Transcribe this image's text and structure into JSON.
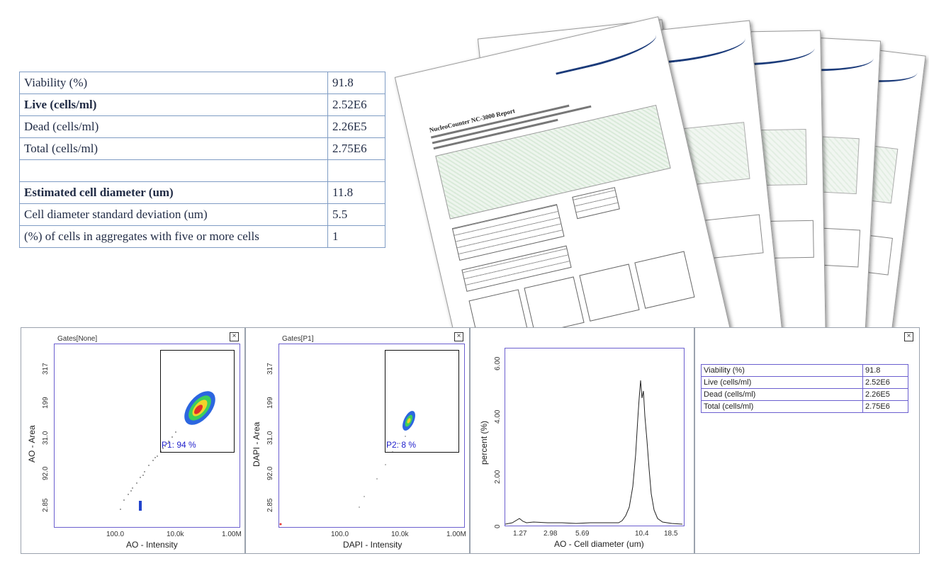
{
  "summary_table": [
    {
      "label": "Viability (%)",
      "value": "91.8"
    },
    {
      "label": "Live (cells/ml)",
      "value": "2.52E6"
    },
    {
      "label": "Dead (cells/ml)",
      "value": "2.26E5"
    },
    {
      "label": "Total (cells/ml)",
      "value": "2.75E6"
    },
    {
      "label": "",
      "value": ""
    },
    {
      "label": "Estimated cell diameter (um)",
      "value": "11.8"
    },
    {
      "label": "Cell diameter standard deviation (um)",
      "value": "5.5"
    },
    {
      "label": "(%) of cells in aggregates with five or more cells",
      "value": "1"
    }
  ],
  "report": {
    "title": "NucleoCounter NC-3000 Report"
  },
  "panels": {
    "p1": {
      "gates": "Gates[None]",
      "ylabel": "AO - Area",
      "xlabel": "AO - Intensity",
      "yticks": [
        "2.85",
        "92.0",
        "31.0",
        "199",
        "317"
      ],
      "xticks": [
        "100.0",
        "10.0k",
        "1.00M"
      ],
      "gate_label": "P1: 94 %"
    },
    "p2": {
      "gates": "Gates[P1]",
      "ylabel": "DAPI - Area",
      "xlabel": "DAPI - Intensity",
      "yticks": [
        "2.85",
        "92.0",
        "31.0",
        "199",
        "317"
      ],
      "xticks": [
        "100.0",
        "10.0k",
        "1.00M"
      ],
      "gate_label": "P2: 8 %"
    },
    "p3": {
      "ylabel": "percent (%)",
      "xlabel": "AO - Cell diameter (um)",
      "yticks": [
        "0",
        "2.00",
        "4.00",
        "6.00"
      ],
      "xticks": [
        "1.27",
        "2.98",
        "5.69",
        "10.4",
        "18.5"
      ]
    },
    "p4": {
      "rows": [
        {
          "label": "Viability (%)",
          "value": "91.8"
        },
        {
          "label": "Live (cells/ml)",
          "value": "2.52E6"
        },
        {
          "label": "Dead (cells/ml)",
          "value": "2.26E5"
        },
        {
          "label": "Total (cells/ml)",
          "value": "2.75E6"
        }
      ]
    }
  },
  "colors": {
    "table_border": "#7f9cc4",
    "plot_border": "#6b5fcf",
    "gate_label": "#2222cc",
    "report_swoosh": "#1b3b7a"
  },
  "icons": {
    "close": "close-box-icon"
  }
}
